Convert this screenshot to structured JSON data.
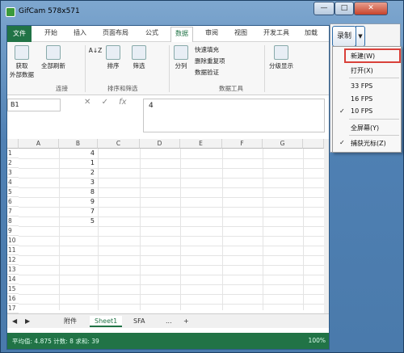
{
  "window": {
    "title": "GifCam 578x571",
    "min": "—",
    "max": "□",
    "close": "✕"
  },
  "tabs": {
    "file": "文件",
    "items": [
      "开始",
      "插入",
      "页面布局",
      "公式",
      "数据",
      "审阅",
      "视图",
      "开发工具",
      "加载"
    ]
  },
  "ribbon": {
    "get_data": [
      "获取",
      "外部数据"
    ],
    "refresh": "全部刷新",
    "group_conn": "连接",
    "sort_az": "A↓Z",
    "sort": "排序",
    "filter": "筛选",
    "group_sort": "排序和筛选",
    "split": "分列",
    "flash_fill": "快速填充",
    "remove_dup": "删除重复项",
    "validate": "数据验证",
    "group_tools": "数据工具",
    "outline": "分级显示"
  },
  "formula": {
    "namebox": "B1",
    "cancel": "✕",
    "enter": "✓",
    "fx": "fx",
    "value": "4"
  },
  "columns": [
    "A",
    "B",
    "C",
    "D",
    "E",
    "F",
    "G"
  ],
  "rows": [
    "1",
    "2",
    "3",
    "4",
    "5",
    "6",
    "7",
    "8",
    "9",
    "10",
    "11",
    "12",
    "13",
    "14",
    "15",
    "16",
    "17"
  ],
  "b_values": [
    "4",
    "1",
    "2",
    "3",
    "8",
    "9",
    "7",
    "5"
  ],
  "sheets": {
    "items": [
      "附件",
      "Sheet1",
      "SFA"
    ],
    "more": "...",
    "add": "+"
  },
  "status": {
    "text": "平均值: 4.875    计数: 8    求和: 39",
    "zoom": "100%"
  },
  "gifcam": {
    "record": "录制",
    "dropdown": "▼"
  },
  "menu": {
    "new": "新建(W)",
    "open": "打开(X)",
    "fps33": "33 FPS",
    "fps16": "16 FPS",
    "fps10": "10 FPS",
    "fullscreen": "全屏幕(Y)",
    "capture_cursor": "捕获光标(Z)",
    "check": "✓"
  },
  "accent": "#217346"
}
